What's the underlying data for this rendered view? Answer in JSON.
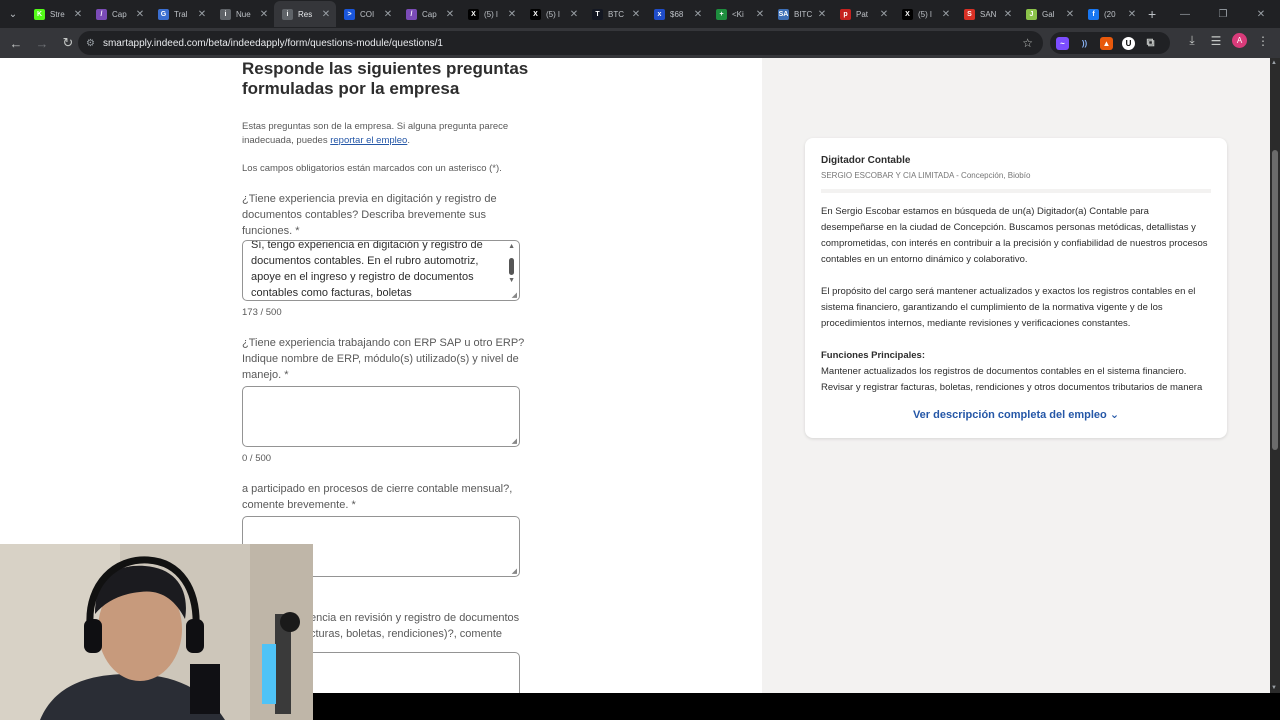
{
  "tabs": [
    {
      "label": "Stre",
      "fav_color": "#53fc18",
      "fav_glyph": "K"
    },
    {
      "label": "Cap",
      "fav_color": "#7b4bb7",
      "fav_glyph": "/"
    },
    {
      "label": "Tral",
      "fav_color": "#3b6fd1",
      "fav_glyph": "G"
    },
    {
      "label": "Nue",
      "fav_color": "#5f6368",
      "fav_glyph": "i"
    },
    {
      "label": "Res",
      "fav_color": "#5f6368",
      "fav_glyph": "i",
      "active": true
    },
    {
      "label": "COI",
      "fav_color": "#1a56db",
      "fav_glyph": ">"
    },
    {
      "label": "Cap",
      "fav_color": "#7b4bb7",
      "fav_glyph": "/"
    },
    {
      "label": "(5) l",
      "fav_color": "#000000",
      "fav_glyph": "X"
    },
    {
      "label": "(5) l",
      "fav_color": "#000000",
      "fav_glyph": "X"
    },
    {
      "label": "BTC",
      "fav_color": "#131722",
      "fav_glyph": "T"
    },
    {
      "label": "$68",
      "fav_color": "#1f4cc9",
      "fav_glyph": "x"
    },
    {
      "label": "<Ki",
      "fav_color": "#1e8e3e",
      "fav_glyph": "+"
    },
    {
      "label": "BITC",
      "fav_color": "#3d6fb6",
      "fav_glyph": "SA"
    },
    {
      "label": "Pat",
      "fav_color": "#c5221f",
      "fav_glyph": "p"
    },
    {
      "label": "(5) l",
      "fav_color": "#000000",
      "fav_glyph": "X"
    },
    {
      "label": "SAN",
      "fav_color": "#d93025",
      "fav_glyph": "S"
    },
    {
      "label": "Gal",
      "fav_color": "#8bc34a",
      "fav_glyph": "J"
    },
    {
      "label": "(20",
      "fav_color": "#1877f2",
      "fav_glyph": "f"
    }
  ],
  "toolbar": {
    "url": "smartapply.indeed.com/beta/indeedapply/form/questions-module/questions/1",
    "avatar_letter": "A"
  },
  "form": {
    "heading": "Responde las siguientes preguntas formuladas por la empresa",
    "intro_before": "Estas preguntas son de la empresa. Si alguna pregunta parece inadecuada, puedes ",
    "intro_link": "reportar el empleo",
    "intro_after": ".",
    "required_note": "Los campos obligatorios están marcados con un asterisco (*).",
    "questions": [
      {
        "label": "¿Tiene experiencia previa en digitación y registro de documentos contables? Describa brevemente sus funciones. *",
        "value": "Sí, tengo experiencia en digitación y registro de documentos contables. En el rubro automotriz, apoye en el ingreso y registro de documentos contables como facturas, boletas",
        "count": "173 / 500"
      },
      {
        "label": "¿Tiene experiencia trabajando con ERP SAP u otro ERP? Indique nombre de ERP, módulo(s) utilizado(s) y nivel de manejo. *",
        "value": "",
        "count": "0 / 500"
      },
      {
        "label": "a participado en procesos de cierre contable mensual?, comente brevemente. *",
        "value": "",
        "count": ""
      },
      {
        "label": "encia en revisión y registro de documentos cturas, boletas, rendiciones)?, comente",
        "value": "",
        "count": ""
      }
    ]
  },
  "job": {
    "title": "Digitador Contable",
    "company": "SERGIO ESCOBAR Y CIA LIMITADA - Concepción, Biobío",
    "p1": "En Sergio Escobar estamos en búsqueda de un(a) Digitador(a) Contable para desempeñarse en la ciudad de Concepción. Buscamos personas metódicas, detallistas y comprometidas, con interés en contribuir a la precisión y confiabilidad de nuestros procesos contables en un entorno dinámico y colaborativo.",
    "p2": "El propósito del cargo será mantener actualizados y exactos los registros contables en el sistema financiero, garantizando el cumplimiento de la normativa vigente y de los procedimientos internos, mediante revisiones y verificaciones constantes.",
    "functions_title": "Funciones Principales:",
    "functions_text": "Mantener actualizados los registros de documentos contables en el sistema financiero. Revisar y registrar facturas, boletas, rendiciones y otros documentos tributarios de manera",
    "more_link": "Ver descripción completa del empleo"
  }
}
